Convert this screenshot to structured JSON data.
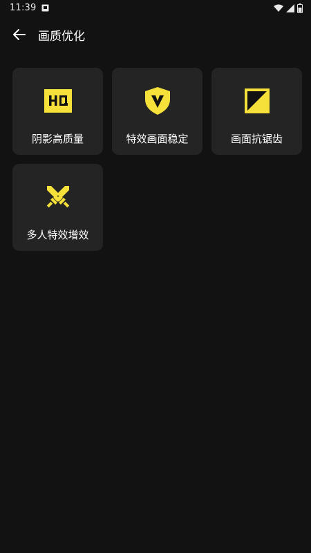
{
  "status_bar": {
    "time": "11:39"
  },
  "header": {
    "title": "画质优化"
  },
  "tiles": [
    {
      "label": "阴影高质量",
      "icon": "hq-icon"
    },
    {
      "label": "特效画面稳定",
      "icon": "shield-icon"
    },
    {
      "label": "画面抗锯齿",
      "icon": "anti-alias-icon"
    },
    {
      "label": "多人特效增效",
      "icon": "crossed-swords-icon"
    }
  ],
  "colors": {
    "background": "#121212",
    "tile": "#242424",
    "accent": "#F5E13A",
    "text": "#FFFFFF"
  }
}
